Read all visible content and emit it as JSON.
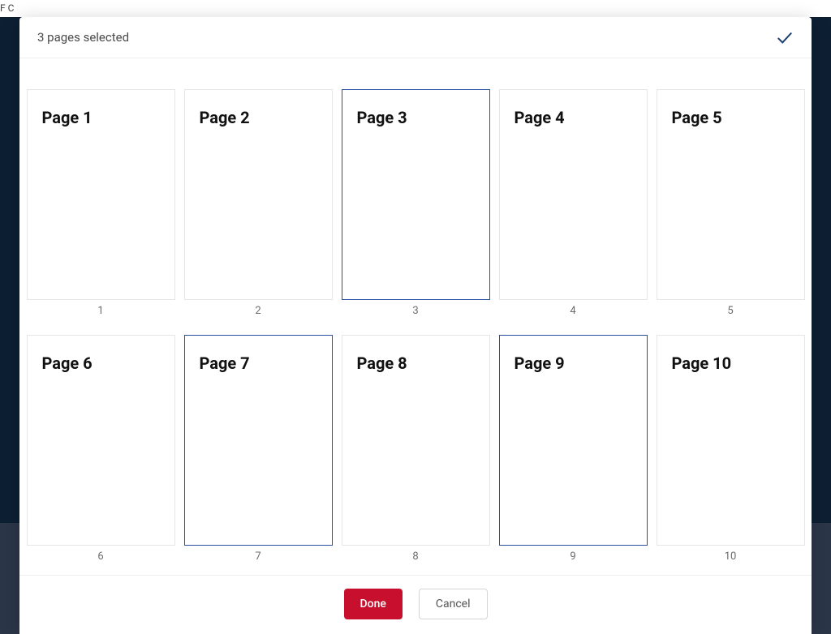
{
  "backdrop": {
    "header_fragment": "F C"
  },
  "modal": {
    "selection_text": "3 pages selected",
    "pages": [
      {
        "label": "Page 1",
        "index": "1",
        "selected": false
      },
      {
        "label": "Page 2",
        "index": "2",
        "selected": false
      },
      {
        "label": "Page 3",
        "index": "3",
        "selected": true
      },
      {
        "label": "Page 4",
        "index": "4",
        "selected": false
      },
      {
        "label": "Page 5",
        "index": "5",
        "selected": false
      },
      {
        "label": "Page 6",
        "index": "6",
        "selected": false
      },
      {
        "label": "Page 7",
        "index": "7",
        "selected": true
      },
      {
        "label": "Page 8",
        "index": "8",
        "selected": false
      },
      {
        "label": "Page 9",
        "index": "9",
        "selected": true
      },
      {
        "label": "Page 10",
        "index": "10",
        "selected": false
      }
    ],
    "buttons": {
      "done": "Done",
      "cancel": "Cancel"
    }
  }
}
